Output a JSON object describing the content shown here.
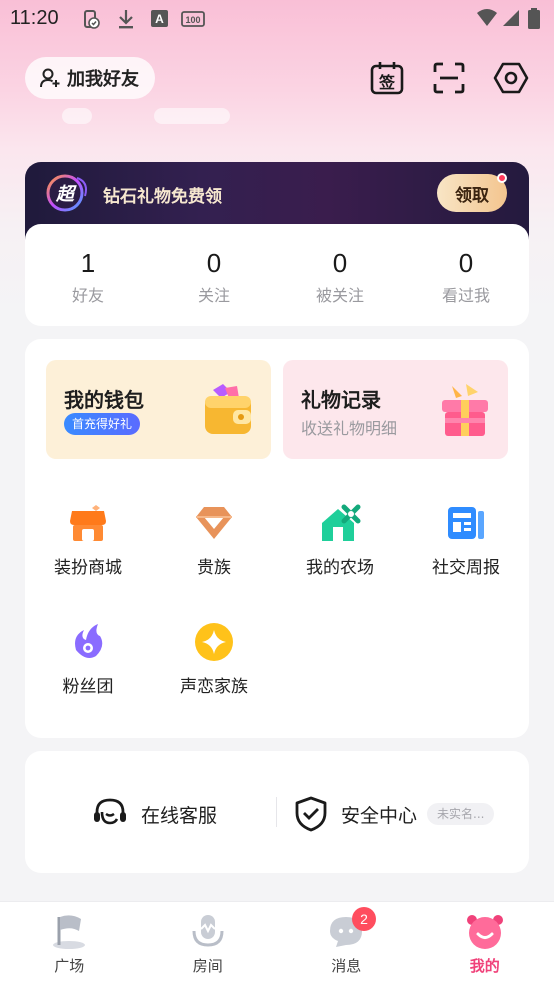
{
  "status_bar": {
    "time": "11:20",
    "icons": [
      "battery-saver-icon",
      "download-icon",
      "text-a-icon",
      "battery-100-icon",
      "wifi-icon",
      "signal-icon",
      "battery-icon"
    ]
  },
  "header": {
    "add_friend_label": "加我好友",
    "icons": [
      "sign-in-calendar-icon",
      "scan-icon",
      "settings-hex-icon"
    ],
    "sign_in_glyph": "签"
  },
  "promo": {
    "badge_text": "超",
    "text": "钻石礼物免费领",
    "button_label": "领取"
  },
  "stats": [
    {
      "value": "1",
      "label": "好友"
    },
    {
      "value": "0",
      "label": "关注"
    },
    {
      "value": "0",
      "label": "被关注"
    },
    {
      "value": "0",
      "label": "看过我"
    }
  ],
  "tiles": {
    "wallet": {
      "title": "我的钱包",
      "badge": "首充得好礼"
    },
    "gifts": {
      "title": "礼物记录",
      "subtitle": "收送礼物明细"
    }
  },
  "features": [
    {
      "label": "装扮商城",
      "icon": "shop-icon"
    },
    {
      "label": "贵族",
      "icon": "diamond-icon"
    },
    {
      "label": "我的农场",
      "icon": "farm-icon"
    },
    {
      "label": "社交周报",
      "icon": "report-icon"
    },
    {
      "label": "粉丝团",
      "icon": "fan-club-icon"
    },
    {
      "label": "声恋家族",
      "icon": "family-star-icon"
    }
  ],
  "service": {
    "support_label": "在线客服",
    "security_label": "安全中心",
    "security_tag": "未实名..."
  },
  "bottom_nav": [
    {
      "label": "广场",
      "icon": "plaza-flag-icon"
    },
    {
      "label": "房间",
      "icon": "room-mic-icon"
    },
    {
      "label": "消息",
      "icon": "message-bubble-icon",
      "badge": "2"
    },
    {
      "label": "我的",
      "icon": "me-face-icon",
      "active": true
    }
  ],
  "colors": {
    "accent": "#f0427a",
    "badge": "#ff4d5e",
    "gold": "#f3c58f"
  }
}
